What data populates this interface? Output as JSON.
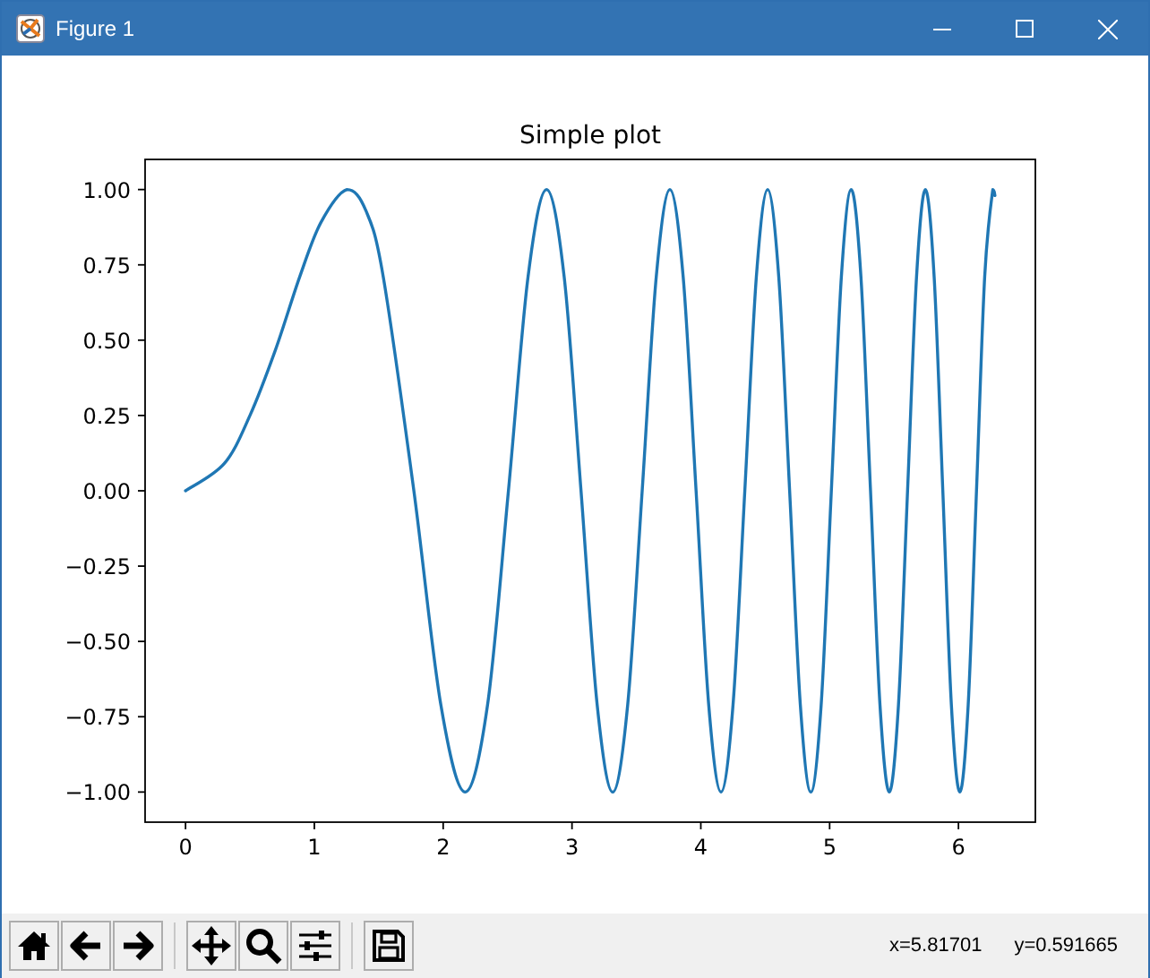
{
  "window": {
    "title": "Figure 1"
  },
  "chart_data": {
    "type": "line",
    "title": "Simple plot",
    "x": [
      0,
      0.3,
      0.5,
      0.7,
      0.8862,
      1.05,
      1.2533,
      1.4,
      1.535,
      1.7725,
      1.9817,
      2.1708,
      2.3447,
      2.5066,
      2.6587,
      2.8025,
      2.9393,
      3.07,
      3.1953,
      3.316,
      3.4324,
      3.5449,
      3.654,
      3.7599,
      3.863,
      3.9633,
      4.0612,
      4.1568,
      4.2502,
      4.3416,
      4.4311,
      4.5189,
      4.605,
      4.6895,
      4.7725,
      4.8541,
      4.9343,
      5.0133,
      5.091,
      5.1676,
      5.243,
      5.3174,
      5.3907,
      5.4631,
      5.5345,
      5.605,
      5.6746,
      5.7434,
      5.8114,
      5.8786,
      5.945,
      6.0107,
      6.0757,
      6.14,
      6.2036,
      6.2666,
      6.2832
    ],
    "series": [
      {
        "color": "#1f77b4",
        "values": [
          0,
          0.09,
          0.25,
          0.47,
          0.71,
          0.89,
          1,
          0.93,
          0.71,
          0,
          -0.71,
          -1,
          -0.71,
          0,
          0.71,
          1,
          0.71,
          0,
          -0.71,
          -1,
          -0.71,
          0,
          0.71,
          1,
          0.71,
          0,
          -0.71,
          -1,
          -0.71,
          0,
          0.71,
          1,
          0.71,
          0,
          -0.71,
          -1,
          -0.71,
          0,
          0.71,
          1,
          0.71,
          0,
          -0.71,
          -1,
          -0.71,
          0,
          0.71,
          1,
          0.71,
          0,
          -0.71,
          -1,
          -0.71,
          0,
          0.71,
          1,
          0.98
        ]
      }
    ],
    "xlim": [
      -0.314,
      6.597
    ],
    "ylim": [
      -1.1,
      1.1
    ],
    "xticks": [
      0,
      1,
      2,
      3,
      4,
      5,
      6
    ],
    "yticks": [
      {
        "value": -1,
        "label": "−1.00"
      },
      {
        "value": -0.75,
        "label": "−0.75"
      },
      {
        "value": -0.5,
        "label": "−0.50"
      },
      {
        "value": -0.25,
        "label": "−0.25"
      },
      {
        "value": 0,
        "label": "0.00"
      },
      {
        "value": 0.25,
        "label": "0.25"
      },
      {
        "value": 0.5,
        "label": "0.50"
      },
      {
        "value": 0.75,
        "label": "0.75"
      },
      {
        "value": 1,
        "label": "1.00"
      }
    ]
  },
  "status": {
    "x_readout": "x=5.81701",
    "y_readout": "y=0.591665"
  }
}
